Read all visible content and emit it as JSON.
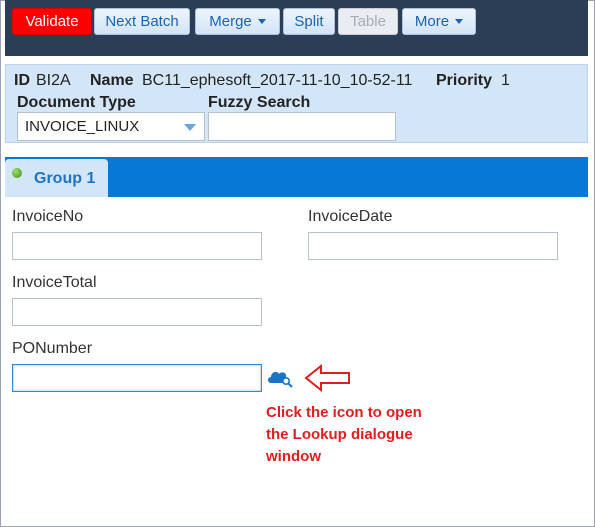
{
  "toolbar": {
    "validate": "Validate",
    "next_batch": "Next Batch",
    "merge": "Merge",
    "split": "Split",
    "table": "Table",
    "more": "More"
  },
  "batch_info": {
    "id_label": "ID",
    "id_value": "BI2A",
    "name_label": "Name",
    "name_value": "BC11_ephesoft_2017-11-10_10-52-11",
    "priority_label": "Priority",
    "priority_value": "1",
    "doc_type_label": "Document Type",
    "doc_type_value": "INVOICE_LINUX",
    "fuzzy_label": "Fuzzy Search",
    "fuzzy_value": ""
  },
  "group_tab": {
    "label": "Group 1"
  },
  "fields": {
    "invoice_no": {
      "label": "InvoiceNo",
      "value": ""
    },
    "invoice_date": {
      "label": "InvoiceDate",
      "value": ""
    },
    "invoice_total": {
      "label": "InvoiceTotal",
      "value": ""
    },
    "po_number": {
      "label": "PONumber",
      "value": ""
    }
  },
  "annotation": {
    "line1": "Click the icon to open",
    "line2": "the Lookup dialogue",
    "line3": "window",
    "color": "#e01e1e"
  },
  "colors": {
    "toolbar_bg": "#2c3e55",
    "accent": "#0878d6",
    "validate": "#ff0000"
  }
}
